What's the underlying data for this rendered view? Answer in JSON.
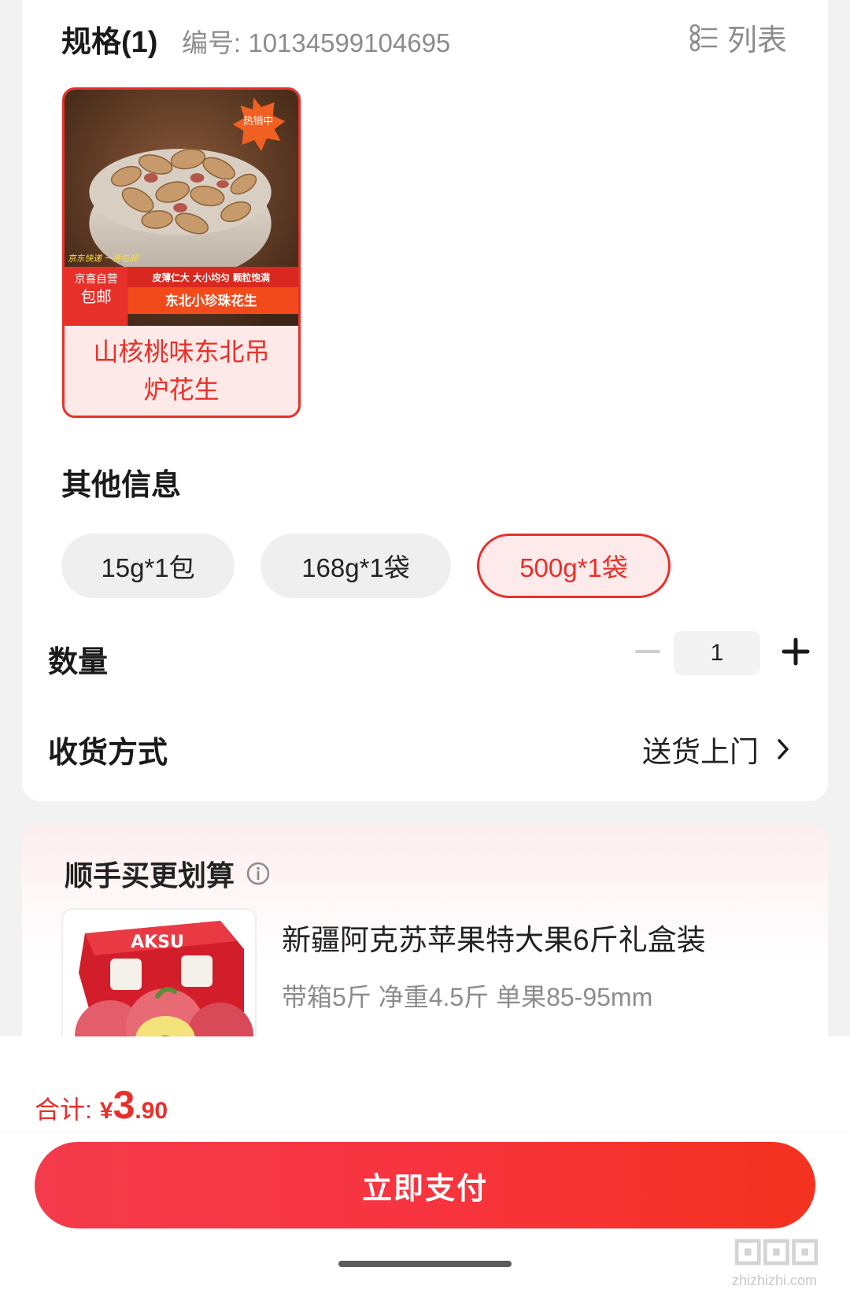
{
  "spec": {
    "title": "规格(1)",
    "code": "编号: 10134599104695",
    "list_label": "列表"
  },
  "variant": {
    "name": "山核桃味东北吊炉花生",
    "badge": "热销中",
    "image_text": {
      "corner": "京东快递 一件包邮",
      "store": "京喜自营",
      "free_ship": "包邮",
      "features": "皮薄仁大  大小均匀  颗粒饱满",
      "product": "东北小珍珠花生"
    }
  },
  "other": {
    "title": "其他信息",
    "options": [
      "15g*1包",
      "168g*1袋",
      "500g*1袋"
    ],
    "selected_index": 2
  },
  "quantity": {
    "label": "数量",
    "value": "1"
  },
  "shipping": {
    "label": "收货方式",
    "value": "送货上门"
  },
  "addon": {
    "title": "顺手买更划算",
    "product_name": "新疆阿克苏苹果特大果6斤礼盒装",
    "product_sub": "带箱5斤 净重4.5斤 单果85-95mm",
    "box_text": "AKSU"
  },
  "total": {
    "label": "合计:",
    "currency": "¥",
    "integer": "3",
    "decimal": ".90"
  },
  "pay_button": "立即支付",
  "watermark": "zhizhizhi.com",
  "colors": {
    "accent": "#e8302a",
    "pay_gradient_start": "#f43b4b",
    "pay_gradient_end": "#f4321f",
    "muted_text": "#8c8c8c"
  }
}
